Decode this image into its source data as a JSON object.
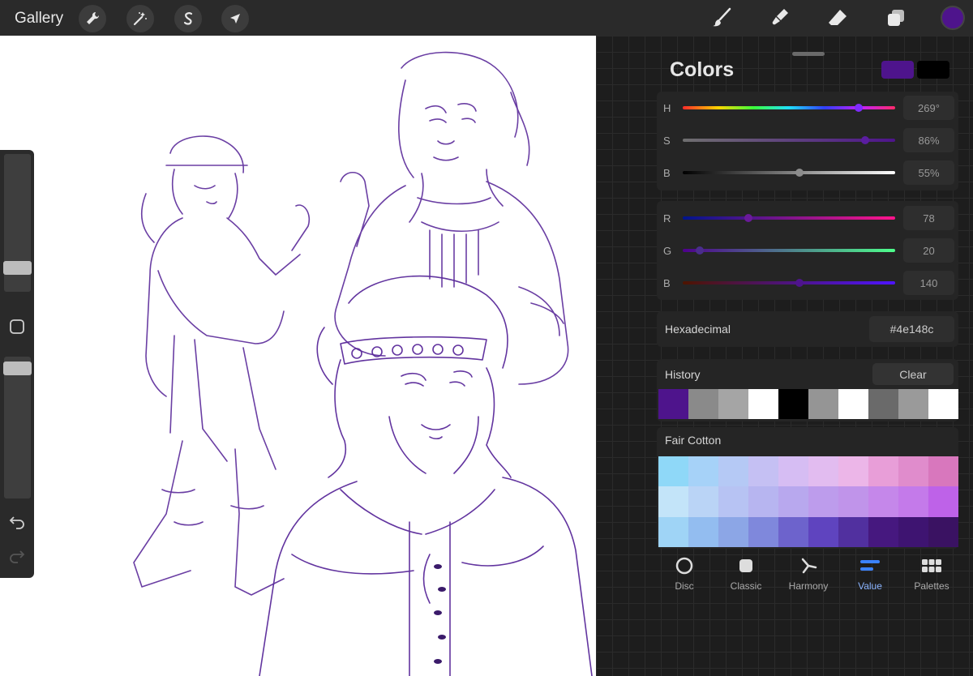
{
  "topbar": {
    "gallery_label": "Gallery",
    "left_tools": [
      "wrench-icon",
      "magic-wand-icon",
      "selection-icon",
      "transform-arrow-icon"
    ],
    "right_tools": [
      "brush-icon",
      "smudge-icon",
      "eraser-icon",
      "layers-icon"
    ],
    "active_color": "#4e148c"
  },
  "sidebar": {
    "brush_size_level": 0.82,
    "opacity_level": 1.0,
    "modify_button": "modify-square-icon",
    "undo": "undo-icon",
    "redo": "redo-icon"
  },
  "colors": {
    "title": "Colors",
    "primary_swatch": "#4e148c",
    "secondary_swatch": "#000000",
    "hsb": [
      {
        "label": "H",
        "value": "269°",
        "fraction": 0.83
      },
      {
        "label": "S",
        "value": "86%",
        "fraction": 0.86
      },
      {
        "label": "B",
        "value": "55%",
        "fraction": 0.55
      }
    ],
    "rgb": [
      {
        "label": "R",
        "value": "78",
        "fraction": 0.31
      },
      {
        "label": "G",
        "value": "20",
        "fraction": 0.08
      },
      {
        "label": "B",
        "value": "140",
        "fraction": 0.55
      }
    ],
    "hex_label": "Hexadecimal",
    "hex_value": "#4e148c",
    "history_label": "History",
    "clear_label": "Clear",
    "history_swatches": [
      "#4e148c",
      "#8a8a8a",
      "#a5a5a5",
      "#ffffff",
      "#000000",
      "#959595",
      "#ffffff",
      "#6a6a6a",
      "#9a9a9a",
      "#ffffff"
    ],
    "palette_name": "Fair Cotton",
    "palette": [
      "#8fd8f8",
      "#a6d2f8",
      "#b5c9f5",
      "#c5c0f3",
      "#d6bdf3",
      "#e2bcf0",
      "#ecb6e8",
      "#e89ed8",
      "#e08ccc",
      "#d877bd",
      "#c3e4f9",
      "#bad4f6",
      "#b7c3f3",
      "#b7b5f0",
      "#b8a8ee",
      "#bd9cec",
      "#c094ea",
      "#c587ea",
      "#c47aea",
      "#be62e8",
      "#9fd4f6",
      "#93bdf0",
      "#8ca6e6",
      "#7f88dc",
      "#6d63cc",
      "#5f44bf",
      "#51309f",
      "#46187f",
      "#3e1471",
      "#3a1262"
    ]
  },
  "tabs": [
    {
      "label": "Disc",
      "icon": "disc-icon"
    },
    {
      "label": "Classic",
      "icon": "classic-square-icon"
    },
    {
      "label": "Harmony",
      "icon": "harmony-icon"
    },
    {
      "label": "Value",
      "icon": "value-sliders-icon",
      "active": true
    },
    {
      "label": "Palettes",
      "icon": "palettes-grid-icon"
    }
  ]
}
